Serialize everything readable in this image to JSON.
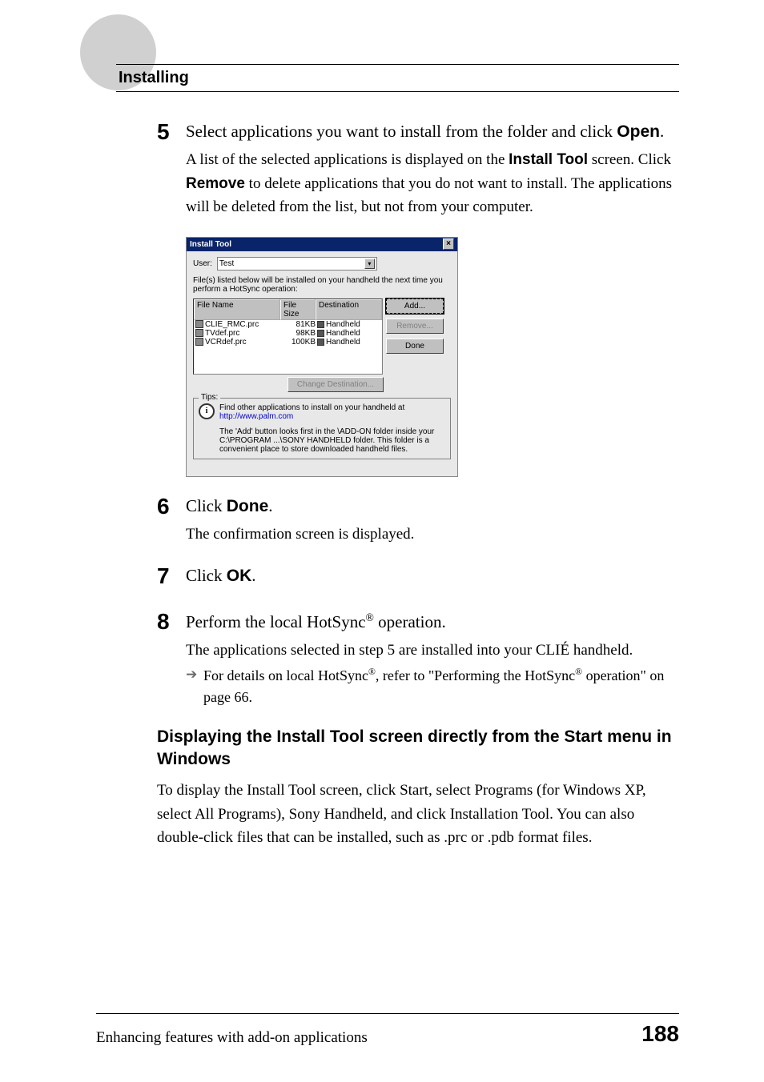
{
  "header": {
    "title": "Installing"
  },
  "steps": {
    "five": {
      "number": "5",
      "main_prefix": "Select applications you want to install from the folder and click ",
      "main_bold": "Open",
      "main_suffix": ".",
      "detail_p1_a": "A list of the selected applications is displayed on the ",
      "detail_p1_b": "Install Tool",
      "detail_p1_c": " screen. Click ",
      "detail_p1_d": "Remove",
      "detail_p1_e": " to delete applications that you do not want to install. The applications will be deleted from the list, but not from your computer."
    },
    "six": {
      "number": "6",
      "main_prefix": "Click ",
      "main_bold": "Done",
      "main_suffix": ".",
      "detail": "The confirmation screen is displayed."
    },
    "seven": {
      "number": "7",
      "main_prefix": "Click ",
      "main_bold": "OK",
      "main_suffix": "."
    },
    "eight": {
      "number": "8",
      "main_prefix": "Perform the local HotSync",
      "main_sup": "®",
      "main_suffix": " operation.",
      "detail": "The applications selected in step 5 are installed into your CLIÉ handheld.",
      "arrow_a": "For details on local HotSync",
      "arrow_sup1": "®",
      "arrow_b": ", refer to \"Performing the HotSync",
      "arrow_sup2": "®",
      "arrow_c": " operation\" on page 66."
    }
  },
  "screenshot": {
    "title": "Install Tool",
    "user_label": "User:",
    "user_value": "Test",
    "note": "File(s) listed below will be installed on your handheld the next time you perform a HotSync operation:",
    "columns": {
      "name": "File Name",
      "size": "File Size",
      "dest": "Destination"
    },
    "rows": [
      {
        "name": "CLIE_RMC.prc",
        "size": "81KB",
        "dest": "Handheld"
      },
      {
        "name": "TVdef.prc",
        "size": "98KB",
        "dest": "Handheld"
      },
      {
        "name": "VCRdef.prc",
        "size": "100KB",
        "dest": "Handheld"
      }
    ],
    "buttons": {
      "add": "Add...",
      "remove": "Remove...",
      "done": "Done",
      "change_dest": "Change Destination..."
    },
    "tips": {
      "label": "Tips:",
      "line1": "Find other applications to install on your handheld at",
      "link": "http://www.palm.com",
      "desc": "The 'Add' button looks first in the \\ADD-ON folder inside your C:\\PROGRAM ...\\SONY HANDHELD folder. This folder is a convenient place to store downloaded handheld files."
    }
  },
  "subsection": {
    "heading": "Displaying the Install Tool screen directly from the Start menu in Windows",
    "p_a": "To display the ",
    "p_b": "Install Tool",
    "p_c": " screen, click ",
    "p_d": "Start",
    "p_e": ", select ",
    "p_f": "Programs",
    "p_g": " (for Windows XP, select ",
    "p_h": "All Programs",
    "p_i": "), ",
    "p_j": "Sony Handheld",
    "p_k": ", and click ",
    "p_l": "Installation Tool",
    "p_m": ". You can also double-click files that can be installed, such as .prc or .pdb format files."
  },
  "footer": {
    "text": "Enhancing features with add-on applications",
    "page": "188"
  }
}
